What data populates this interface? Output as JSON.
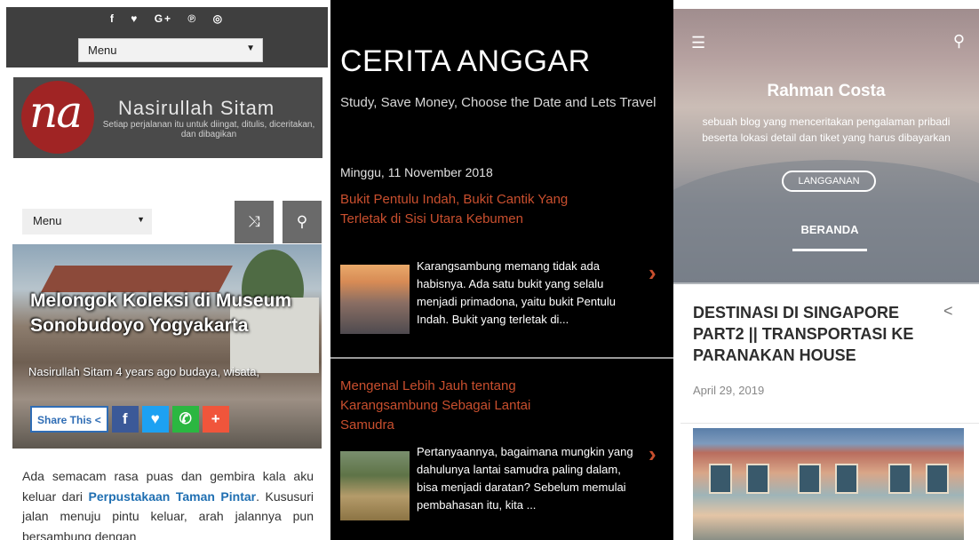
{
  "panel1": {
    "social_icons": [
      {
        "name": "facebook",
        "glyph": "f"
      },
      {
        "name": "twitter",
        "glyph": "♥"
      },
      {
        "name": "google-plus",
        "glyph": "G+"
      },
      {
        "name": "pinterest",
        "glyph": "℗"
      },
      {
        "name": "instagram",
        "glyph": "◎"
      }
    ],
    "top_menu_label": "Menu",
    "logo": {
      "mark": "na",
      "name": "Nasirullah Sitam",
      "tagline": "Setiap perjalanan itu untuk diingat, ditulis, diceritakan, dan dibagikan"
    },
    "nav_menu_label": "Menu",
    "post": {
      "title": "Melongok Koleksi di Museum Sonobudoyo Yogyakarta",
      "meta": "Nasirullah Sitam  4 years ago  budaya, wisata,",
      "share_label": "Share This"
    },
    "body_text_before": "Ada semacam rasa puas dan gembira kala aku keluar dari ",
    "body_link": "Perpustakaan Taman Pintar",
    "body_text_after": ". Kususuri jalan menuju pintu keluar, arah jalannya pun bersambung dengan"
  },
  "panel2": {
    "blog_title": "CERITA ANGGAR",
    "tagline": "Study, Save Money, Choose the Date and Lets Travel",
    "date": "Minggu, 11 November 2018",
    "posts": [
      {
        "title": "Bukit Pentulu Indah, Bukit Cantik Yang Terletak di Sisi Utara Kebumen",
        "excerpt": "Karangsambung memang tidak ada habisnya. Ada satu bukit yang selalu menjadi primadona, yaitu bukit Pentulu Indah. Bukit yang terletak di..."
      },
      {
        "title": "Mengenal Lebih Jauh tentang Karangsambung Sebagai Lantai Samudra",
        "excerpt": "Pertanyaannya, bagaimana mungkin yang dahulunya lantai samudra paling dalam, bisa menjadi daratan? Sebelum memulai pembahasan itu, kita ..."
      }
    ],
    "accent_color": "#c94f2e"
  },
  "panel3": {
    "blog_title": "Rahman Costa",
    "description": "sebuah blog yang menceritakan pengalaman pribadi beserta lokasi detail dan tiket yang harus dibayarkan",
    "subscribe_label": "LANGGANAN",
    "tab_label": "BERANDA",
    "post": {
      "title": "DESTINASI DI SINGAPORE PART2 || TRANSPORTASI KE PARANAKAN HOUSE",
      "date": "April 29, 2019"
    }
  }
}
